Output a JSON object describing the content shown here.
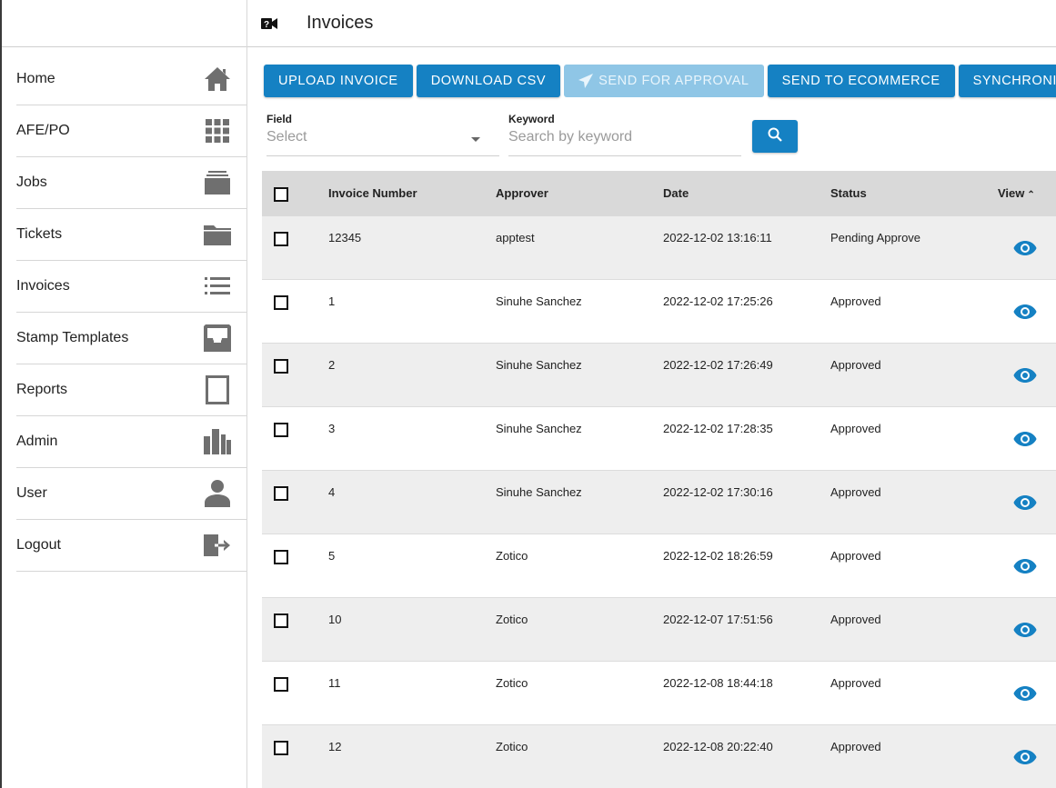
{
  "header": {
    "title": "Invoices",
    "icon": "video-question-icon"
  },
  "sidebar": {
    "items": [
      {
        "label": "Home",
        "icon": "home-icon"
      },
      {
        "label": "AFE/PO",
        "icon": "grid-icon"
      },
      {
        "label": "Jobs",
        "icon": "layers-icon"
      },
      {
        "label": "Tickets",
        "icon": "folder-icon"
      },
      {
        "label": "Invoices",
        "icon": "list-icon"
      },
      {
        "label": "Stamp Templates",
        "icon": "inbox-icon"
      },
      {
        "label": "Reports",
        "icon": "tablet-icon"
      },
      {
        "label": "Admin",
        "icon": "bar-chart-icon"
      },
      {
        "label": "User",
        "icon": "person-icon"
      },
      {
        "label": "Logout",
        "icon": "exit-icon"
      }
    ]
  },
  "toolbar": {
    "upload": "UPLOAD INVOICE",
    "download": "DOWNLOAD CSV",
    "send_approval": "SEND FOR APPROVAL",
    "send_ecommerce": "SEND TO ECOMMERCE",
    "synchronize": "SYNCHRONIZE"
  },
  "filters": {
    "field_label": "Field",
    "field_placeholder": "Select",
    "keyword_label": "Keyword",
    "keyword_placeholder": "Search by keyword"
  },
  "table": {
    "columns": [
      "Invoice Number",
      "Approver",
      "Date",
      "Status",
      "View"
    ],
    "rows": [
      {
        "number": "12345",
        "approver": "apptest",
        "date": "2022-12-02 13:16:11",
        "status": "Pending Approve"
      },
      {
        "number": "1",
        "approver": "Sinuhe Sanchez",
        "date": "2022-12-02 17:25:26",
        "status": "Approved"
      },
      {
        "number": "2",
        "approver": "Sinuhe Sanchez",
        "date": "2022-12-02 17:26:49",
        "status": "Approved"
      },
      {
        "number": "3",
        "approver": "Sinuhe Sanchez",
        "date": "2022-12-02 17:28:35",
        "status": "Approved"
      },
      {
        "number": "4",
        "approver": "Sinuhe Sanchez",
        "date": "2022-12-02 17:30:16",
        "status": "Approved"
      },
      {
        "number": "5",
        "approver": "Zotico",
        "date": "2022-12-02 18:26:59",
        "status": "Approved"
      },
      {
        "number": "10",
        "approver": "Zotico",
        "date": "2022-12-07 17:51:56",
        "status": "Approved"
      },
      {
        "number": "11",
        "approver": "Zotico",
        "date": "2022-12-08 18:44:18",
        "status": "Approved"
      },
      {
        "number": "12",
        "approver": "Zotico",
        "date": "2022-12-08 20:22:40",
        "status": "Approved"
      }
    ]
  },
  "colors": {
    "primary": "#1581c3",
    "primary_disabled": "#8fc6e6",
    "header_row": "#d9d9d9",
    "alt_row": "#eeeeee"
  }
}
